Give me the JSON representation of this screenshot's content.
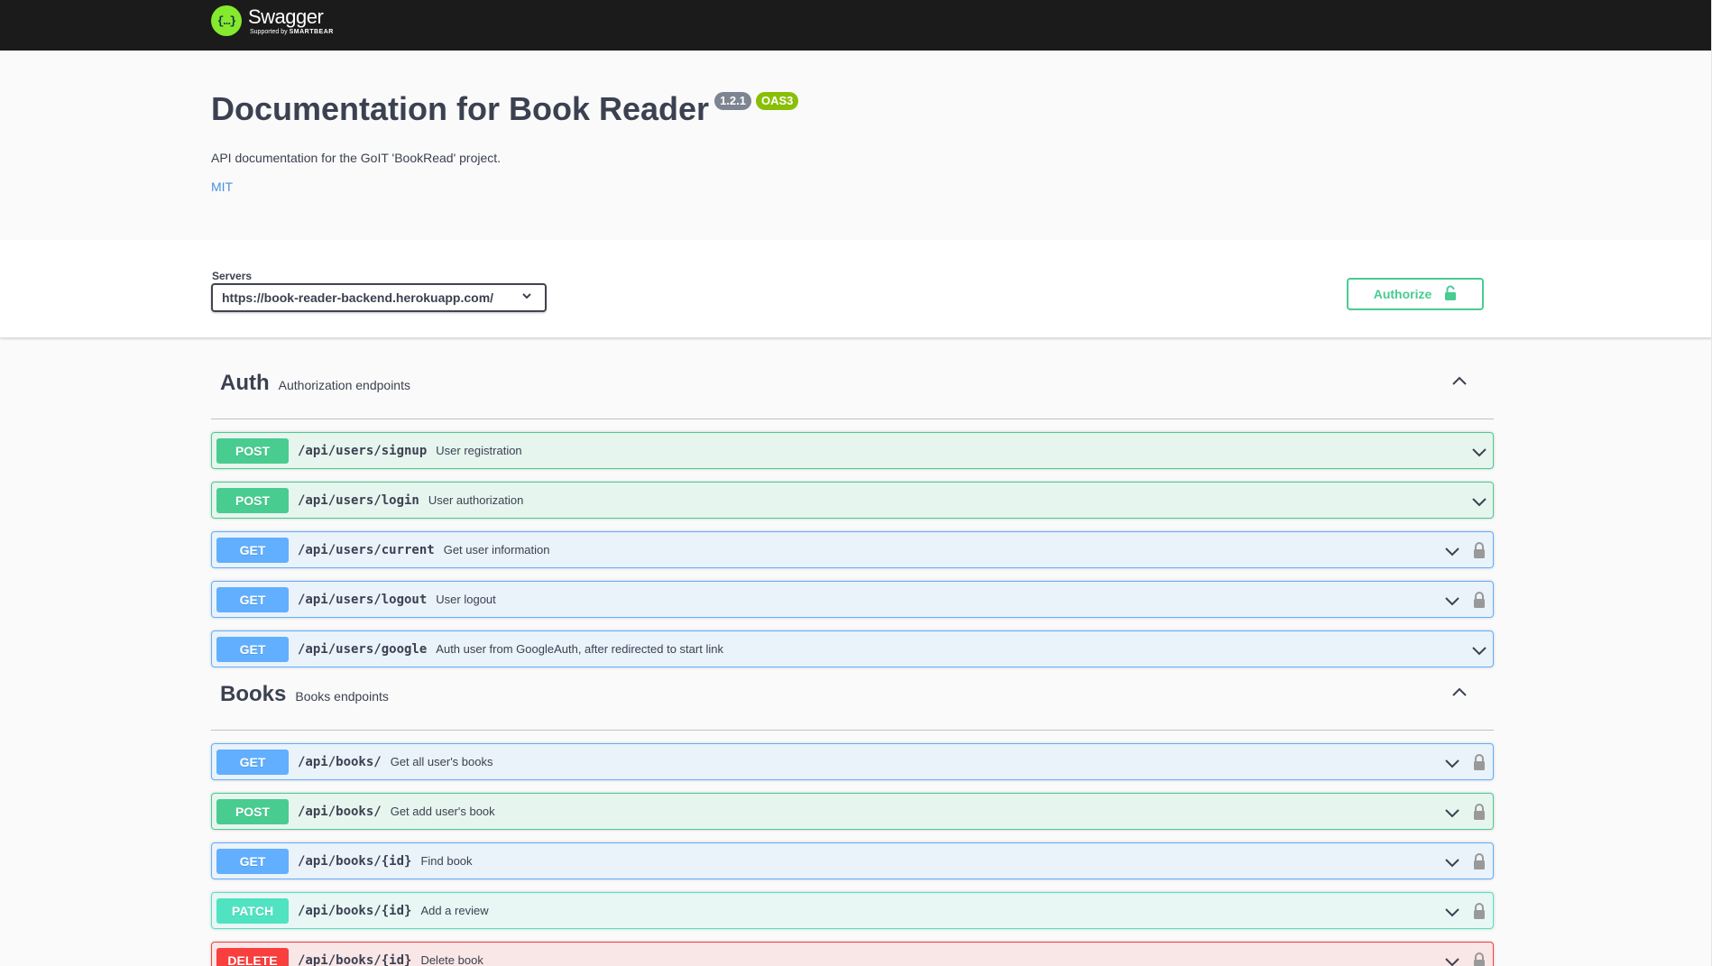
{
  "brand": {
    "name": "Swagger",
    "tagline_prefix": "Supported by",
    "tagline_company": "SMARTBEAR",
    "logo_icon": "swagger-logo-icon",
    "accent": "#85ea2d"
  },
  "info": {
    "title": "Documentation for Book Reader",
    "version": "1.2.1",
    "oas": "OAS3",
    "description": "API documentation for the GoIT 'BookRead' project.",
    "license": "MIT"
  },
  "servers": {
    "label": "Servers",
    "selected": "https://book-reader-backend.herokuapp.com/"
  },
  "authorize": {
    "label": "Authorize",
    "icon": "unlock-icon",
    "color": "#49cc90"
  },
  "colors": {
    "post": "#49cc90",
    "get": "#61affe",
    "patch": "#50e3c2",
    "delete": "#f93e3e"
  },
  "sections": [
    {
      "name": "Auth",
      "description": "Authorization endpoints",
      "operations": [
        {
          "method": "POST",
          "path": "/api/users/signup",
          "summary": "User registration",
          "locked": false
        },
        {
          "method": "POST",
          "path": "/api/users/login",
          "summary": "User authorization",
          "locked": false
        },
        {
          "method": "GET",
          "path": "/api/users/current",
          "summary": "Get user information",
          "locked": true
        },
        {
          "method": "GET",
          "path": "/api/users/logout",
          "summary": "User logout",
          "locked": true
        },
        {
          "method": "GET",
          "path": "/api/users/google",
          "summary": "Auth user from GoogleAuth, after redirected to start link",
          "locked": false
        }
      ]
    },
    {
      "name": "Books",
      "description": "Books endpoints",
      "operations": [
        {
          "method": "GET",
          "path": "/api/books/",
          "summary": "Get all user's books",
          "locked": true
        },
        {
          "method": "POST",
          "path": "/api/books/",
          "summary": "Get add user's book",
          "locked": true
        },
        {
          "method": "GET",
          "path": "/api/books/{id}",
          "summary": "Find book",
          "locked": true
        },
        {
          "method": "PATCH",
          "path": "/api/books/{id}",
          "summary": "Add a review",
          "locked": true
        },
        {
          "method": "DELETE",
          "path": "/api/books/{id}",
          "summary": "Delete book",
          "locked": true
        }
      ]
    }
  ]
}
